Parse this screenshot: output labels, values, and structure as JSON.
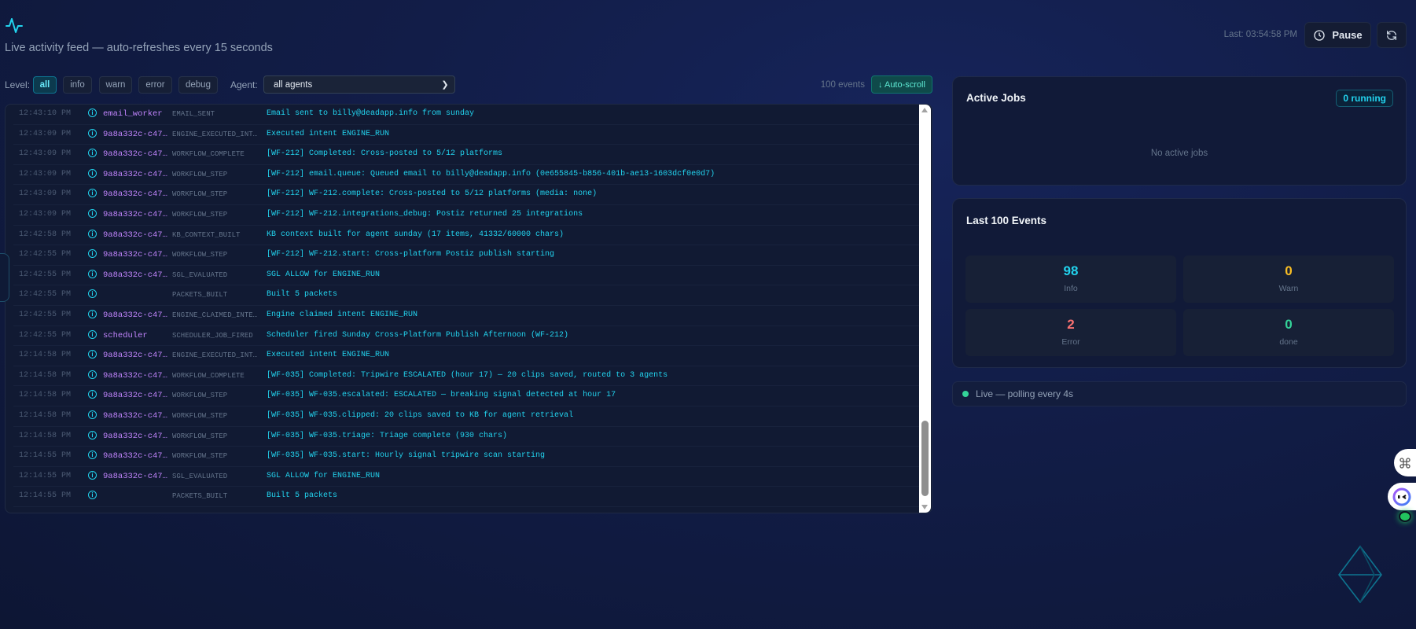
{
  "header": {
    "icon": "activity-pulse-icon",
    "subtitle": "Live activity feed — auto-refreshes every 15 seconds",
    "last_updated": "Last: 03:54:58 PM",
    "pause_label": "Pause"
  },
  "filters": {
    "level_label": "Level:",
    "levels": [
      "all",
      "info",
      "warn",
      "error",
      "debug"
    ],
    "active_level": "all",
    "agent_label": "Agent:",
    "agent_value": "all agents",
    "event_count": "100 events",
    "autoscroll_label": "↓ Auto-scroll"
  },
  "log": [
    {
      "time": "12:43:10 PM",
      "agent": "email_worker",
      "type": "EMAIL_SENT",
      "message": "Email sent to billy@deadapp.info from sunday"
    },
    {
      "time": "12:43:09 PM",
      "agent": "9a8a332c-c47…",
      "type": "ENGINE_EXECUTED_INT…",
      "message": "Executed intent ENGINE_RUN"
    },
    {
      "time": "12:43:09 PM",
      "agent": "9a8a332c-c47…",
      "type": "WORKFLOW_COMPLETE",
      "message": "[WF-212] Completed: Cross-posted to 5/12 platforms"
    },
    {
      "time": "12:43:09 PM",
      "agent": "9a8a332c-c47…",
      "type": "WORKFLOW_STEP",
      "message": "[WF-212] email.queue: Queued email to billy@deadapp.info (0e655845-b856-401b-ae13-1603dcf0e0d7)"
    },
    {
      "time": "12:43:09 PM",
      "agent": "9a8a332c-c47…",
      "type": "WORKFLOW_STEP",
      "message": "[WF-212] WF-212.complete: Cross-posted to 5/12 platforms (media: none)"
    },
    {
      "time": "12:43:09 PM",
      "agent": "9a8a332c-c47…",
      "type": "WORKFLOW_STEP",
      "message": "[WF-212] WF-212.integrations_debug: Postiz returned 25 integrations"
    },
    {
      "time": "12:42:58 PM",
      "agent": "9a8a332c-c47…",
      "type": "KB_CONTEXT_BUILT",
      "message": "KB context built for agent sunday (17 items, 41332/60000 chars)"
    },
    {
      "time": "12:42:55 PM",
      "agent": "9a8a332c-c47…",
      "type": "WORKFLOW_STEP",
      "message": "[WF-212] WF-212.start: Cross-platform Postiz publish starting"
    },
    {
      "time": "12:42:55 PM",
      "agent": "9a8a332c-c47…",
      "type": "SGL_EVALUATED",
      "message": "SGL ALLOW for ENGINE_RUN"
    },
    {
      "time": "12:42:55 PM",
      "agent": "",
      "type": "PACKETS_BUILT",
      "message": "Built 5 packets"
    },
    {
      "time": "12:42:55 PM",
      "agent": "9a8a332c-c47…",
      "type": "ENGINE_CLAIMED_INTE…",
      "message": "Engine claimed intent ENGINE_RUN"
    },
    {
      "time": "12:42:55 PM",
      "agent": "scheduler",
      "type": "SCHEDULER_JOB_FIRED",
      "message": "Scheduler fired Sunday Cross-Platform Publish Afternoon (WF-212)"
    },
    {
      "time": "12:14:58 PM",
      "agent": "9a8a332c-c47…",
      "type": "ENGINE_EXECUTED_INT…",
      "message": "Executed intent ENGINE_RUN"
    },
    {
      "time": "12:14:58 PM",
      "agent": "9a8a332c-c47…",
      "type": "WORKFLOW_COMPLETE",
      "message": "[WF-035] Completed: Tripwire ESCALATED (hour 17) — 20 clips saved, routed to 3 agents"
    },
    {
      "time": "12:14:58 PM",
      "agent": "9a8a332c-c47…",
      "type": "WORKFLOW_STEP",
      "message": "[WF-035] WF-035.escalated: ESCALATED — breaking signal detected at hour 17"
    },
    {
      "time": "12:14:58 PM",
      "agent": "9a8a332c-c47…",
      "type": "WORKFLOW_STEP",
      "message": "[WF-035] WF-035.clipped: 20 clips saved to KB for agent retrieval"
    },
    {
      "time": "12:14:58 PM",
      "agent": "9a8a332c-c47…",
      "type": "WORKFLOW_STEP",
      "message": "[WF-035] WF-035.triage: Triage complete (930 chars)"
    },
    {
      "time": "12:14:55 PM",
      "agent": "9a8a332c-c47…",
      "type": "WORKFLOW_STEP",
      "message": "[WF-035] WF-035.start: Hourly signal tripwire scan starting"
    },
    {
      "time": "12:14:55 PM",
      "agent": "9a8a332c-c47…",
      "type": "SGL_EVALUATED",
      "message": "SGL ALLOW for ENGINE_RUN"
    },
    {
      "time": "12:14:55 PM",
      "agent": "",
      "type": "PACKETS_BUILT",
      "message": "Built 5 packets"
    }
  ],
  "active_jobs": {
    "title": "Active Jobs",
    "badge": "0 running",
    "empty": "No active jobs"
  },
  "events_summary": {
    "title": "Last 100 Events",
    "stats": [
      {
        "value": "98",
        "label": "Info",
        "color": "#22d3ee"
      },
      {
        "value": "0",
        "label": "Warn",
        "color": "#fbbf24"
      },
      {
        "value": "2",
        "label": "Error",
        "color": "#f87171"
      },
      {
        "value": "0",
        "label": "done",
        "color": "#34d399"
      }
    ]
  },
  "status": {
    "text": "Live — polling every 4s",
    "color": "#34d399"
  }
}
